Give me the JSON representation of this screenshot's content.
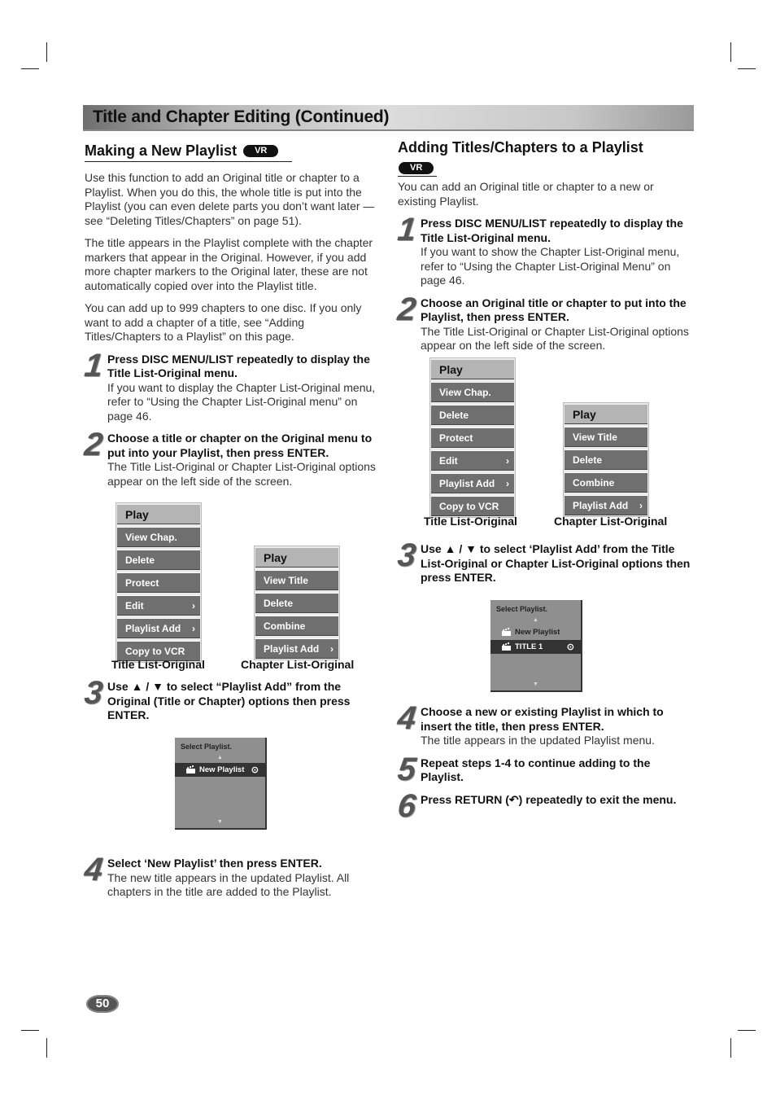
{
  "page_title": "Title and Chapter Editing (Continued)",
  "page_number": "50",
  "left": {
    "heading": "Making a New Playlist",
    "badge": "VR",
    "paragraphs": [
      "Use this function to add an Original title or chapter to a Playlist. When you do this, the whole title is put into the Playlist (you can even delete parts you don’t want later — see “Deleting Titles/Chapters” on page 51).",
      "The title appears in the Playlist complete with the chapter markers that appear in the Original. However, if you add more chapter markers to the Original later, these are not automatically copied over into the Playlist title.",
      "You can add up to 999 chapters to one disc. If you only want to add a chapter of a title, see “Adding Titles/Chapters to a Playlist” on this page."
    ],
    "steps": [
      {
        "num": "1",
        "bold": "Press DISC MENU/LIST repeatedly to display the Title List-Original menu.",
        "text": "If you want to display the Chapter List-Original menu, refer to “Using the Chapter List-Original menu” on page 46."
      },
      {
        "num": "2",
        "bold": "Choose a title or chapter on the Original menu to put into your Playlist, then press ENTER.",
        "text": "The Title List-Original or Chapter List-Original options appear on the left side of the screen."
      },
      {
        "num": "3",
        "bold": "Use ▲ / ▼ to select “Playlist Add” from the Original (Title or Chapter) options then press ENTER.",
        "text": ""
      },
      {
        "num": "4",
        "bold": "Select ‘New Playlist’ then press ENTER.",
        "text": "The new title appears in the updated Playlist. All chapters in the title are added to the Playlist."
      }
    ],
    "title_menu": {
      "caption": "Title List-Original",
      "items": [
        "Play",
        "View Chap.",
        "Delete",
        "Protect",
        "Edit",
        "Playlist Add",
        "Copy to VCR"
      ]
    },
    "chapter_menu": {
      "caption": "Chapter List-Original",
      "items": [
        "Play",
        "View Title",
        "Delete",
        "Combine",
        "Playlist Add"
      ]
    },
    "osd": {
      "title": "Select Playlist.",
      "rows": [
        "New Playlist"
      ],
      "selected": "New Playlist"
    }
  },
  "right": {
    "heading": "Adding Titles/Chapters to a Playlist",
    "badge": "VR",
    "intro": "You can add an Original title or chapter to a new or existing Playlist.",
    "steps": [
      {
        "num": "1",
        "bold": "Press DISC MENU/LIST repeatedly to display the Title List-Original menu.",
        "text": "If you want to show the Chapter List-Original menu, refer to “Using the Chapter List-Original Menu” on page 46."
      },
      {
        "num": "2",
        "bold": "Choose an Original title or chapter to put into the Playlist, then press ENTER.",
        "text": "The Title List-Original or Chapter List-Original options appear on the left side of the screen."
      },
      {
        "num": "3",
        "bold": "Use ▲ / ▼ to select ‘Playlist Add’ from the Title List-Original or Chapter List-Original options then press ENTER.",
        "text": ""
      },
      {
        "num": "4",
        "bold": "Choose a new or existing Playlist in which to insert the title, then press ENTER.",
        "text": "The title appears in the updated Playlist menu."
      },
      {
        "num": "5",
        "bold": "Repeat steps 1-4 to continue adding to the Playlist.",
        "text": ""
      },
      {
        "num": "6",
        "bold": "Press RETURN (↶) repeatedly to exit the menu.",
        "text": ""
      }
    ],
    "title_menu": {
      "caption": "Title List-Original",
      "items": [
        "Play",
        "View Chap.",
        "Delete",
        "Protect",
        "Edit",
        "Playlist Add",
        "Copy to VCR"
      ]
    },
    "chapter_menu": {
      "caption": "Chapter List-Original",
      "items": [
        "Play",
        "View Title",
        "Delete",
        "Combine",
        "Playlist Add"
      ]
    },
    "osd": {
      "title": "Select Playlist.",
      "rows": [
        "New Playlist",
        "TITLE 1"
      ],
      "selected": "TITLE 1"
    }
  },
  "icons": {
    "submenu": "›",
    "target": "⊙",
    "up": "▲",
    "down": "▼"
  }
}
